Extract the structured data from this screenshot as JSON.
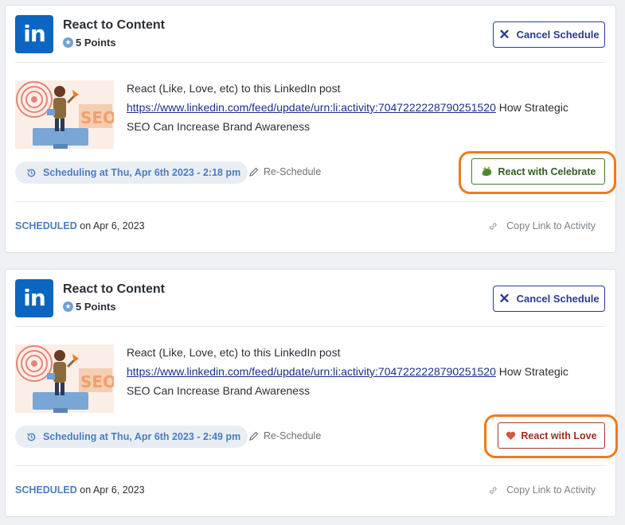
{
  "cards": [
    {
      "logo_text": "in",
      "title": "React to Content",
      "points": "5 Points",
      "cancel_label": "Cancel Schedule",
      "description_prefix": "React (Like, Love, etc) to this LinkedIn post",
      "link_text": "https://www.linkedin.com/feed/update/urn:li:activity:7047222228790251520",
      "description_suffix": " How Strategic SEO Can Increase Brand Awareness",
      "schedule_text": "Scheduling at Thu, Apr 6th 2023 - 2:18 pm",
      "reschedule_label": "Re-Schedule",
      "react_label": "React with Celebrate",
      "react_icon": "celebrate-icon",
      "status": "SCHEDULED",
      "status_date": "on Apr 6, 2023",
      "copy_label": "Copy Link to Activity",
      "thumb_text": "SEO"
    },
    {
      "logo_text": "in",
      "title": "React to Content",
      "points": "5 Points",
      "cancel_label": "Cancel Schedule",
      "description_prefix": "React (Like, Love, etc) to this LinkedIn post",
      "link_text": "https://www.linkedin.com/feed/update/urn:li:activity:7047222228790251520",
      "description_suffix": " How Strategic SEO Can Increase Brand Awareness",
      "schedule_text": "Scheduling at Thu, Apr 6th 2023 - 2:49 pm",
      "reschedule_label": "Re-Schedule",
      "react_label": "React with Love",
      "react_icon": "heart-icon",
      "status": "SCHEDULED",
      "status_date": "on Apr 6, 2023",
      "copy_label": "Copy Link to Activity",
      "thumb_text": "SEO"
    }
  ],
  "colors": {
    "linkedin_blue": "#0a66c2",
    "accent_navy": "#2a3a8c",
    "schedule_blue": "#4a7dbf",
    "celebrate_green": "#2f5e20",
    "love_red": "#9a2e1e",
    "highlight_orange": "#f07a1a"
  }
}
